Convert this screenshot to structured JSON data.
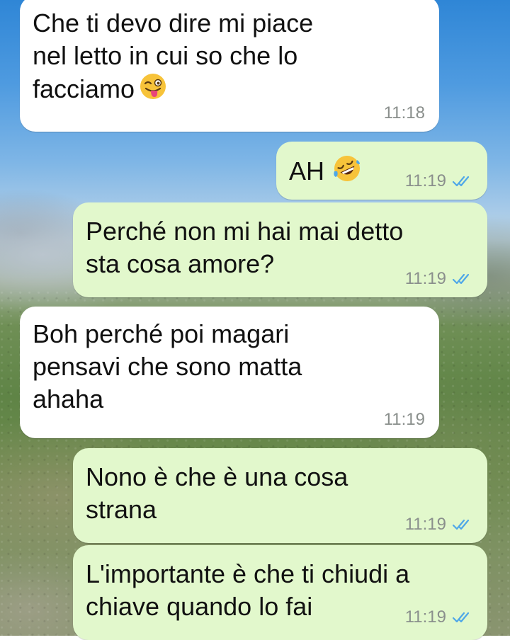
{
  "conversation": {
    "messages": [
      {
        "direction": "in",
        "text": "Che ti devo dire mi piace\nnel letto in cui so che lo\nfacciamo",
        "emoji": "winking-tongue-face-emoji",
        "time": "11:18",
        "ticks": "none"
      },
      {
        "direction": "out",
        "text": "AH",
        "emoji": "rolling-on-floor-laughing-emoji",
        "time": "11:19",
        "ticks": "read"
      },
      {
        "direction": "out",
        "text": "Perché non mi hai mai detto\nsta cosa amore?",
        "time": "11:19",
        "ticks": "read"
      },
      {
        "direction": "in",
        "text": "Boh perché poi magari\npensavi che sono matta\nahaha",
        "time": "11:19",
        "ticks": "none"
      },
      {
        "direction": "out",
        "text": "Nono è che è una cosa\nstrana",
        "time": "11:19",
        "ticks": "read"
      },
      {
        "direction": "out",
        "text": "L'importante è che ti chiudi a\nchiave quando lo fai",
        "time": "11:19",
        "ticks": "read"
      }
    ]
  },
  "colors": {
    "incoming_bubble": "#ffffff",
    "outgoing_bubble": "#e2f8cc",
    "read_ticks": "#4fa7e8",
    "timestamp": "#8a8f8c"
  }
}
